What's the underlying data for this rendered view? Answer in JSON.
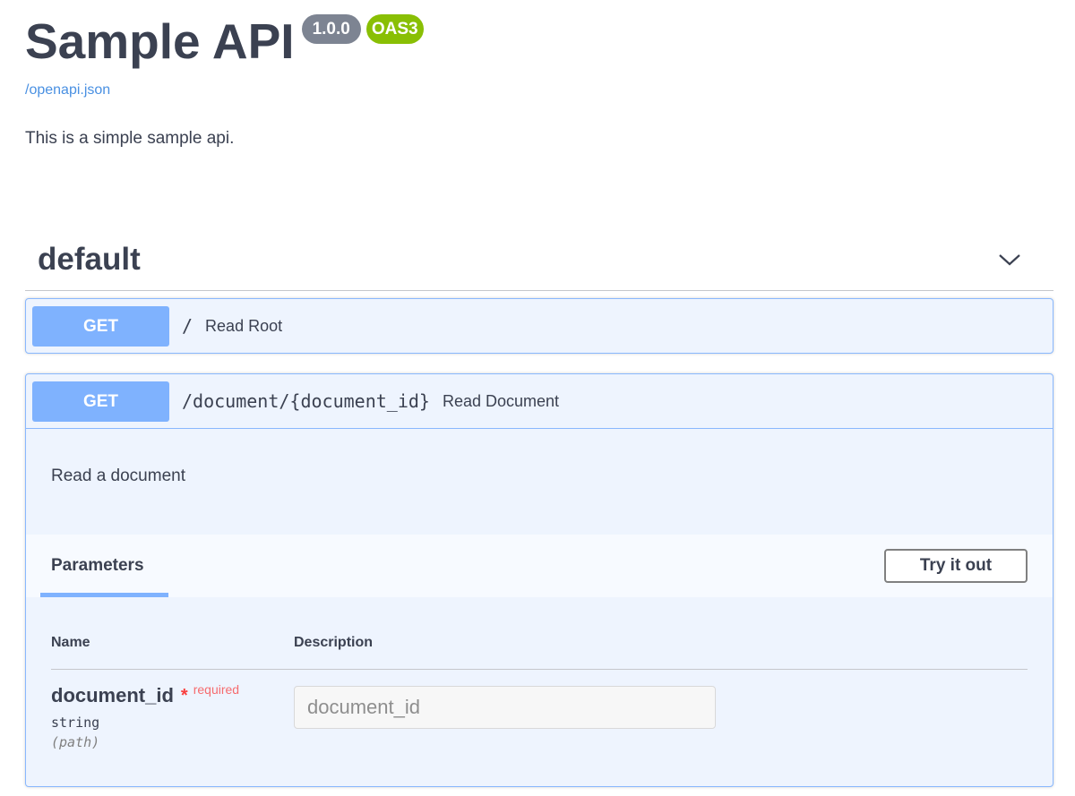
{
  "info": {
    "title": "Sample API",
    "version": "1.0.0",
    "oas": "OAS3",
    "spec_link": "/openapi.json",
    "description": "This is a simple sample api."
  },
  "tag": {
    "name": "default",
    "toggle_icon": "chevron-down-icon"
  },
  "operations": [
    {
      "method": "GET",
      "path": "/",
      "summary": "Read Root"
    },
    {
      "method": "GET",
      "path": "/document/{document_id}",
      "summary": "Read Document",
      "description": "Read a document",
      "parameters_tab": "Parameters",
      "try_button": "Try it out",
      "columns": {
        "name": "Name",
        "description": "Description"
      },
      "parameters": [
        {
          "name": "document_id",
          "required_star": "*",
          "required_label": "required",
          "type": "string",
          "in": "(path)",
          "placeholder": "document_id"
        }
      ]
    }
  ],
  "colors": {
    "get_accent": "#7fb2fe",
    "get_border": "#89b8fe",
    "get_background": "#eef4fe",
    "required": "#f93e3e",
    "version_badge": "#7d8492",
    "oas_badge": "#89bf04"
  }
}
